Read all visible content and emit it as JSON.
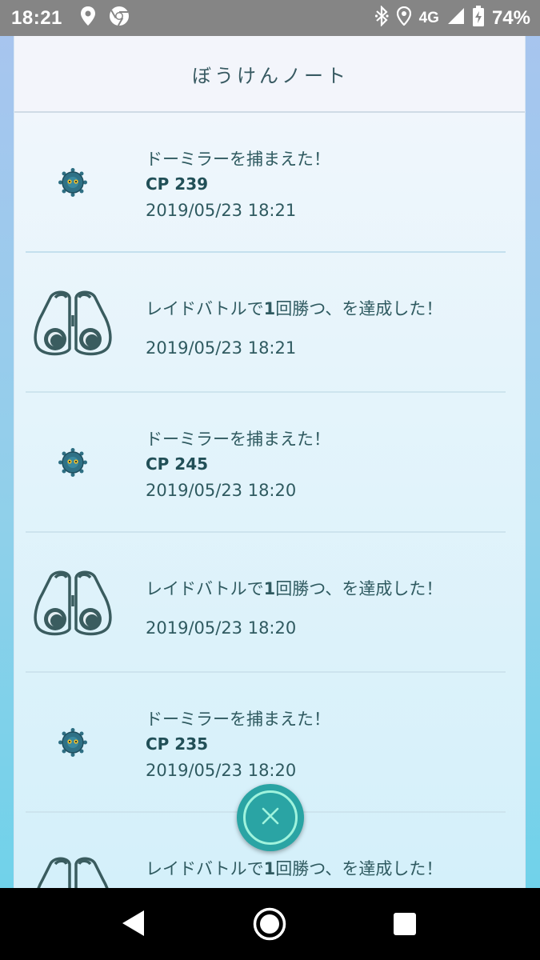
{
  "status_bar": {
    "time": "18:21",
    "left_icons": [
      "location-pin-icon",
      "chrome-icon"
    ],
    "network": "4G",
    "battery_percent": "74%",
    "right_icons": [
      "bluetooth-icon",
      "location-icon",
      "signal-icon",
      "battery-charging-icon"
    ]
  },
  "header": {
    "title": "ぼうけんノート"
  },
  "entries": [
    {
      "type": "catch",
      "icon": "bronzor-icon",
      "title": "ドーミラーを捕まえた！",
      "cp": "CP 239",
      "date": "2019/05/23 18:21"
    },
    {
      "type": "raid",
      "icon": "binoculars-icon",
      "title_pre": "レイドバトルで",
      "title_num": "1",
      "title_post": "回勝つ、を達成した！",
      "date": "2019/05/23 18:21"
    },
    {
      "type": "catch",
      "icon": "bronzor-icon",
      "title": "ドーミラーを捕まえた！",
      "cp": "CP 245",
      "date": "2019/05/23 18:20"
    },
    {
      "type": "raid",
      "icon": "binoculars-icon",
      "title_pre": "レイドバトルで",
      "title_num": "1",
      "title_post": "回勝つ、を達成した！",
      "date": "2019/05/23 18:20"
    },
    {
      "type": "catch",
      "icon": "bronzor-icon",
      "title": "ドーミラーを捕まえた！",
      "cp": "CP 235",
      "date": "2019/05/23 18:20"
    },
    {
      "type": "raid",
      "icon": "binoculars-icon",
      "title_pre": "レイドバトルで",
      "title_num": "1",
      "title_post": "回勝つ、を達成した！",
      "date": ""
    }
  ],
  "close_button": {
    "icon": "close-icon"
  },
  "nav_bar": {
    "icons": [
      "back-icon",
      "home-icon",
      "recents-icon"
    ]
  },
  "colors": {
    "accent": "#2aa4a4",
    "text": "#2f5a60",
    "status_bar": "#858585"
  }
}
